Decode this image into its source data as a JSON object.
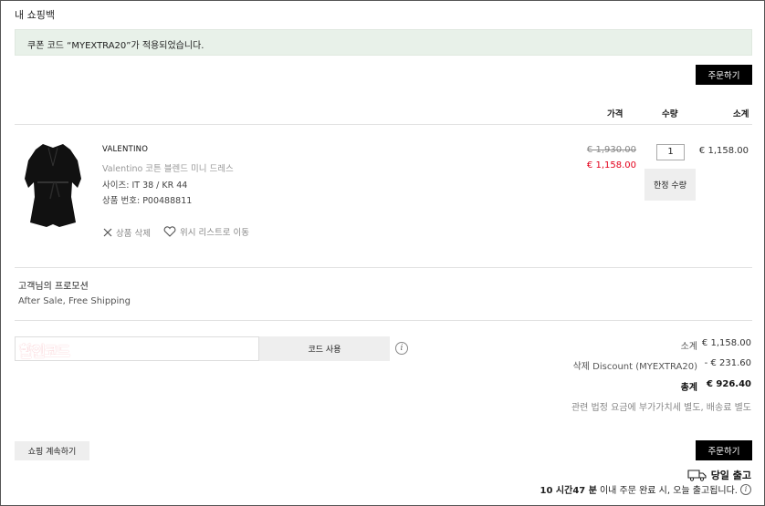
{
  "page_title": "내 쇼핑백",
  "notice": "쿠폰 코드 “MYEXTRA20”가 적용되었습니다.",
  "checkout_label": "주문하기",
  "columns": {
    "price": "가격",
    "qty": "수량",
    "subtotal": "소계"
  },
  "item": {
    "brand": "VALENTINO",
    "name": "Valentino 코튼 블렌드 미니 드레스",
    "size": "사이즈: IT 38 / KR 44",
    "product_no": "상품 번호: P00488811",
    "remove_label": "상품 삭제",
    "wishlist_label": "위시 리스트로 이동",
    "old_price": "€ 1,930.00",
    "new_price": "€ 1,158.00",
    "qty": "1",
    "limit_label": "한정 수량",
    "subtotal": "€ 1,158.00"
  },
  "promo": {
    "title": "고객님의 프로모션",
    "text": "After Sale, Free Shipping"
  },
  "discount": {
    "label": "할인코드",
    "apply_label": "코드 사용",
    "info_glyph": "i"
  },
  "summary": {
    "subtotal_label": "소계",
    "subtotal_value": "€ 1,158.00",
    "discount_label": "삭제 Discount (MYEXTRA20)",
    "discount_value": "- € 231.60",
    "total_label": "총계",
    "total_value": "€ 926.40",
    "tax_note": "관련 법정 요금에 부가가치세 별도, 배송료 별도"
  },
  "continue_label": "쇼핑 계속하기",
  "same_day": {
    "label": "당일 출고",
    "time": "10 시간47 분",
    "text": " 이내 주문 완료 시, 오늘 출고됩니다.",
    "info_glyph": "i"
  },
  "colors": {
    "accent_red": "#e3001b",
    "notice_bg": "#e8f1e9",
    "button_black": "#000000"
  }
}
